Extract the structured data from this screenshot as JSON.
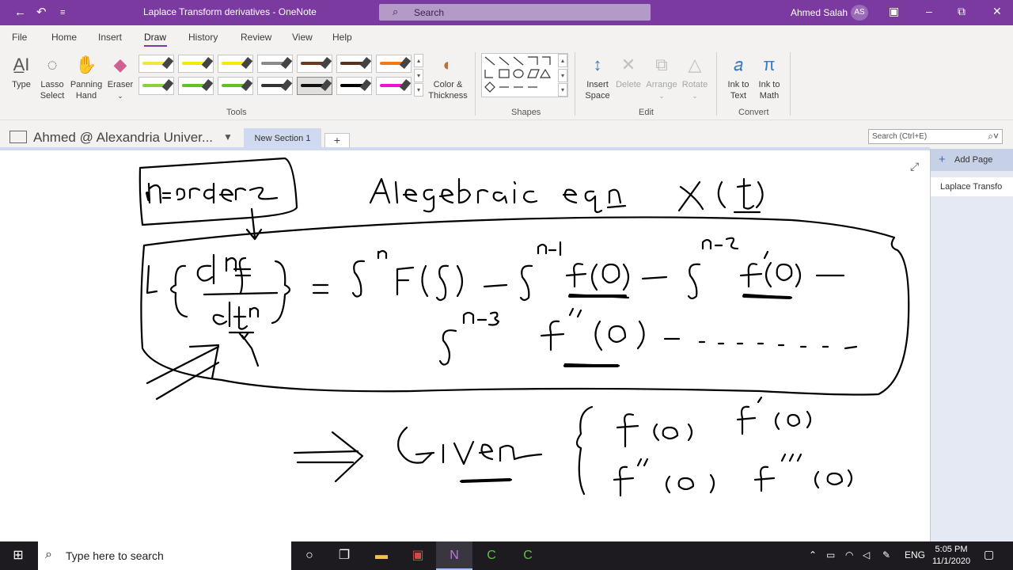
{
  "window": {
    "title": "Laplace Transform derivatives - OneNote",
    "search_placeholder": "Search",
    "user_name": "Ahmed Salah",
    "user_initials": "AS"
  },
  "tabs": [
    "File",
    "Home",
    "Insert",
    "Draw",
    "History",
    "Review",
    "View",
    "Help"
  ],
  "ribbon": {
    "tools": {
      "type": "Type",
      "lasso_1": "Lasso",
      "lasso_2": "Select",
      "panning_1": "Panning",
      "panning_2": "Hand",
      "eraser": "Eraser",
      "color_1": "Color &",
      "color_2": "Thickness",
      "group": "Tools"
    },
    "shapes_group": "Shapes",
    "edit": {
      "insert_1": "Insert",
      "insert_2": "Space",
      "delete": "Delete",
      "arrange": "Arrange",
      "rotate": "Rotate",
      "group": "Edit"
    },
    "convert": {
      "ink_text_1": "Ink to",
      "ink_text_2": "Text",
      "ink_math_1": "Ink to",
      "ink_math_2": "Math",
      "group": "Convert"
    },
    "pen_colors": [
      "#f5e342",
      "#f2e800",
      "#f8e800",
      "#8a8a8a",
      "#6b3a1f",
      "#5a3219",
      "#f07b14",
      "#8bcf3c",
      "#62c21e",
      "#62c21e",
      "#333333",
      "#111111",
      "#000000",
      "#f012d4"
    ]
  },
  "notebook": {
    "name": "Ahmed @ Alexandria Univer...",
    "section": "New Section 1",
    "search_placeholder": "Search (Ctrl+E)"
  },
  "pages": {
    "add_label": "Add Page",
    "items": [
      "Laplace Transfo"
    ]
  },
  "taskbar": {
    "search_placeholder": "Type here to search",
    "lang": "ENG",
    "time": "5:05 PM",
    "date": "11/1/2020"
  }
}
